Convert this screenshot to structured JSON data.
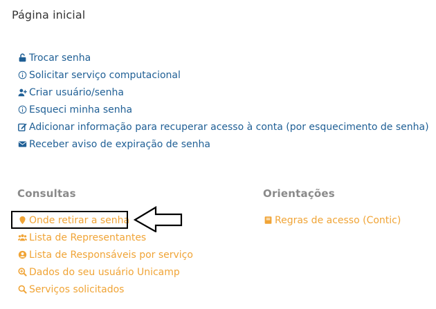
{
  "page": {
    "title": "Página inicial"
  },
  "main_links": [
    {
      "icon": "unlock-icon",
      "label": "Trocar senha"
    },
    {
      "icon": "info-circle-icon",
      "label": "Solicitar serviço computacional"
    },
    {
      "icon": "user-plus-icon",
      "label": "Criar usuário/senha"
    },
    {
      "icon": "info-circle-icon",
      "label": "Esqueci minha senha"
    },
    {
      "icon": "edit-icon",
      "label": "Adicionar informação para recuperar acesso à conta (por esquecimento de senha)"
    },
    {
      "icon": "envelope-icon",
      "label": "Receber aviso de expiração de senha"
    }
  ],
  "consultas": {
    "heading": "Consultas",
    "items": [
      {
        "icon": "map-pin-icon",
        "label": "Onde retirar a senha"
      },
      {
        "icon": "users-icon",
        "label": "Lista de Representantes"
      },
      {
        "icon": "user-circle-icon",
        "label": "Lista de Responsáveis por serviço"
      },
      {
        "icon": "search-plus-icon",
        "label": "Dados do seu usuário Unicamp"
      },
      {
        "icon": "search-icon",
        "label": "Serviços solicitados"
      }
    ]
  },
  "orientacoes": {
    "heading": "Orientações",
    "items": [
      {
        "icon": "book-icon",
        "label": "Regras de acesso (Contic)"
      }
    ]
  },
  "colors": {
    "link_blue": "#1f5f95",
    "link_orange": "#f0a436",
    "heading_gray": "#8a8a8a"
  }
}
